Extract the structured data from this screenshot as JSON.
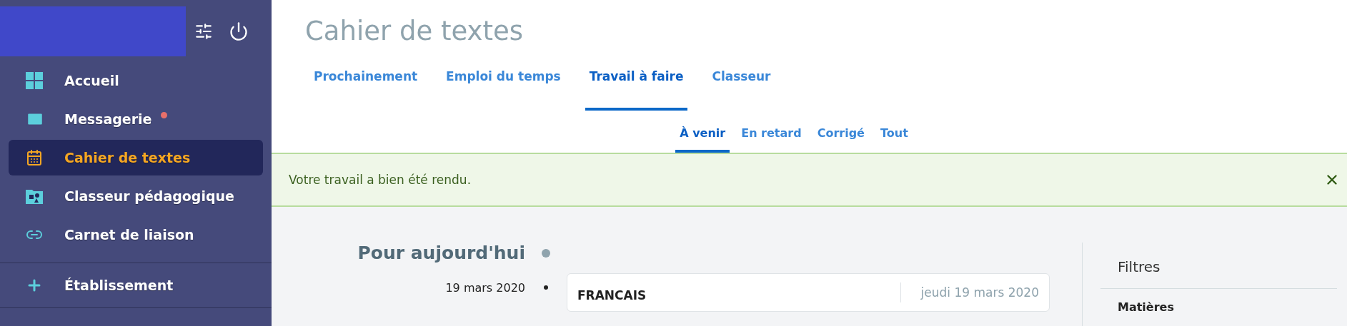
{
  "sidebar": {
    "items": [
      {
        "label": "Accueil",
        "selected": false,
        "unread": false
      },
      {
        "label": "Messagerie",
        "selected": false,
        "unread": true
      },
      {
        "label": "Cahier de textes",
        "selected": true,
        "unread": false
      },
      {
        "label": "Classeur pédagogique",
        "selected": false,
        "unread": false
      },
      {
        "label": "Carnet de liaison",
        "selected": false,
        "unread": false
      }
    ],
    "sections": [
      {
        "label": "Établissement"
      }
    ]
  },
  "page": {
    "title": "Cahier de textes"
  },
  "tabs": [
    {
      "label": "Prochainement",
      "selected": false
    },
    {
      "label": "Emploi du temps",
      "selected": false
    },
    {
      "label": "Travail à faire",
      "selected": true
    },
    {
      "label": "Classeur",
      "selected": false
    }
  ],
  "subtabs": [
    {
      "label": "À venir",
      "selected": true
    },
    {
      "label": "En retard",
      "selected": false
    },
    {
      "label": "Corrigé",
      "selected": false
    },
    {
      "label": "Tout",
      "selected": false
    }
  ],
  "alert": {
    "message": "Votre travail a bien été rendu."
  },
  "timeline": {
    "heading": "Pour aujourd'hui",
    "entries": [
      {
        "date": "19 mars 2020",
        "subject": "FRANCAIS",
        "day": "jeudi 19 mars 2020"
      }
    ]
  },
  "filters": {
    "title": "Filtres",
    "sections": [
      "Matières"
    ]
  }
}
